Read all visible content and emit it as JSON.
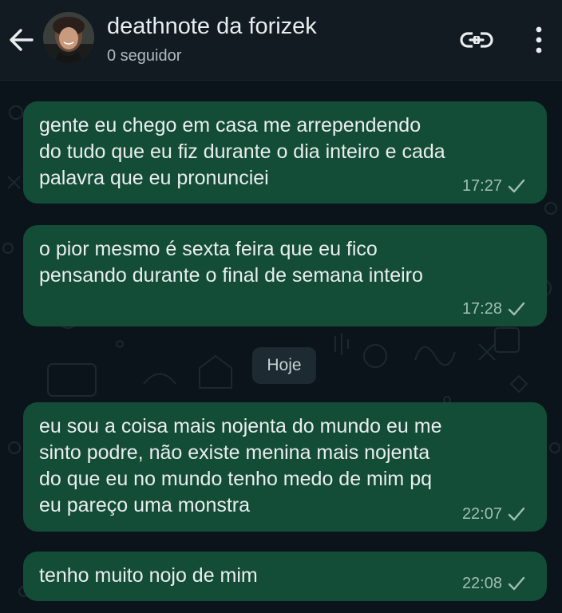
{
  "header": {
    "title": "deathnote da forizek",
    "subtitle": "0 seguidor",
    "back_icon": "arrow-left-icon",
    "link_icon": "link-icon",
    "menu_icon": "more-vert-icon"
  },
  "messages": [
    {
      "text": "gente eu chego em casa me arrependendo\ndo tudo que eu fiz durante o dia inteiro e cada\npalavra que eu pronunciei",
      "time": "17:27",
      "status": "sent"
    },
    {
      "text": "o pior mesmo é sexta feira que eu fico\npensando durante o final de semana inteiro",
      "time": "17:28",
      "status": "sent"
    },
    {
      "text": "eu sou a coisa mais nojenta do mundo eu me\nsinto podre, não existe menina mais nojenta\ndo que eu no mundo tenho medo de mim pq\neu pareço uma monstra",
      "time": "22:07",
      "status": "sent"
    },
    {
      "text": "tenho muito nojo de mim",
      "time": "22:08",
      "status": "sent"
    }
  ],
  "date_divider": "Hoje",
  "colors": {
    "background": "#0b141a",
    "header": "#111b21",
    "bubble": "#144d37",
    "text": "#e9edef",
    "meta": "#9fbfb2"
  }
}
